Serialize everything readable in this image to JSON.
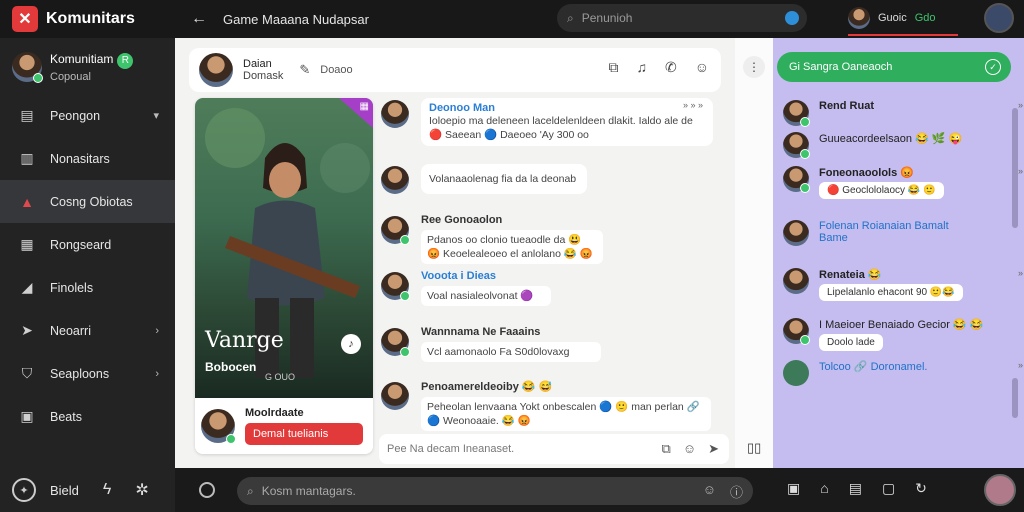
{
  "app": {
    "brand": "Komunitars",
    "title": "Game Maaana Nudapsar",
    "search_placeholder": "Penunioh",
    "user_name": "Guoic",
    "user_status": "Gdo"
  },
  "sidebar": {
    "profile_name": "Komunitiam",
    "profile_sub": "Copoual",
    "profile_badge": "R",
    "items": [
      {
        "label": "Peongon",
        "icon": "building-icon",
        "chevron": true
      },
      {
        "label": "Nonasitars",
        "icon": "chart-icon",
        "chevron": false
      },
      {
        "label": "Cosng Obiotas",
        "icon": "people-icon",
        "chevron": false,
        "active": true
      },
      {
        "label": "Rongseard",
        "icon": "card-icon",
        "chevron": false
      },
      {
        "label": "Finolels",
        "icon": "pin-icon",
        "chevron": false
      },
      {
        "label": "Neoarri",
        "icon": "arrow-icon",
        "chevron": true
      },
      {
        "label": "Seaploons",
        "icon": "shield-icon",
        "chevron": true
      },
      {
        "label": "Beats",
        "icon": "grid-icon",
        "chevron": false
      }
    ],
    "footer_label": "Bield"
  },
  "chat": {
    "head_name": "Daian",
    "head_sub": "Domask",
    "head_extra": "Doaoo",
    "game_title": "Vanrge",
    "game_sub": "Bobocen",
    "game_sub2": "G OUO",
    "host_name": "Moolrdaate",
    "host_button": "Demal tuelianis",
    "messages": [
      {
        "name": "Deonoo Man",
        "name_blue": true,
        "text": "Ioloepio ma deleneen laceldelenldeen dlakit. Ialdo ale de 🔴 Saeean 🔵 Daeoeo 'Ay 300 oo",
        "time": "» » »"
      },
      {
        "name": "",
        "name_blue": false,
        "text": "Volanaaolenag fia da la deonab",
        "time": ""
      },
      {
        "name": "Ree Gonoaolon",
        "name_blue": false,
        "text": "Pdanos oo clonio tueaodle da 😃 😡 Keoelealeoeo el anlolano 😂 😡",
        "time": ""
      },
      {
        "name": "Vooota i Dieas",
        "name_blue": true,
        "text": "Voal nasialeolvonat 🟣",
        "time": ""
      },
      {
        "name": "Wannnama Ne Faaains",
        "name_blue": false,
        "text": "Vcl aamonaolo Fa S0d0lovaxg",
        "time": ""
      },
      {
        "name": "Penoamereldeoiby 😂 😅",
        "name_blue": false,
        "text": "Peheolan lenvaana Yokt onbescalen 🔵 🙂 man perlan 🔗 🔵 Weonoaaie. 😂 😡",
        "time": ""
      }
    ],
    "input_placeholder": "Pee Na decam Ineanaset."
  },
  "right": {
    "search_label": "Gi Sangra Oaneaoch",
    "items": [
      {
        "name": "Rend Ruat",
        "blue": false,
        "bubble": "",
        "time": "» » »"
      },
      {
        "name": "Guueacordeelsaon 😂 🌿 😜",
        "blue": false,
        "bubble": "",
        "time": ""
      },
      {
        "name": "Foneonaoolols 😡",
        "blue": false,
        "bubble": "🔴 Geoclololaocy 😂 🙂",
        "time": "» » »"
      },
      {
        "name": "Folenan Roianaian Bamalt Bame",
        "blue": true,
        "bubble": "",
        "time": ""
      },
      {
        "name": "Renateia 😂",
        "blue": false,
        "bubble": "Lipelalanlo ehacont 90 🙂😂",
        "time": "» » »"
      },
      {
        "name": "I Maeioer Benaiado Gecior 😂 😂",
        "blue": false,
        "bubble": "Doolo lade",
        "time": ""
      },
      {
        "name": "Tolcoo 🔗 Doronamel.",
        "blue": true,
        "bubble": "",
        "time": "» » »"
      }
    ]
  },
  "composer": {
    "placeholder": "Kosm mantagars."
  },
  "colors": {
    "accent_red": "#e23a3a",
    "accent_green": "#2fae5e",
    "right_panel": "#c5bcef"
  }
}
